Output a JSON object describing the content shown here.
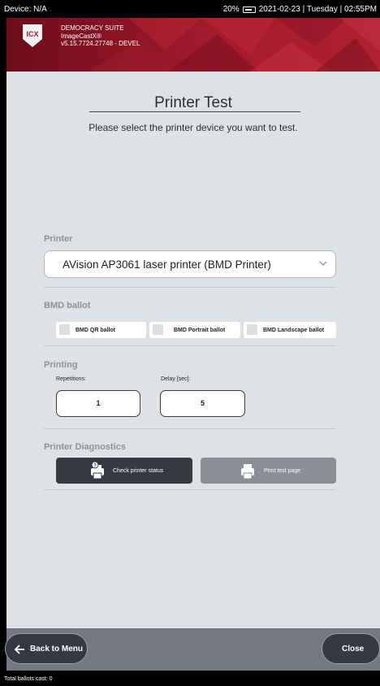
{
  "statusbar": {
    "device": "Device: N/A",
    "battery": "20%",
    "datetime": "2021-02-23 | Tuesday | 02:55PM"
  },
  "header": {
    "logo_text": "ICX",
    "suite": "DEMOCRACY SUITE",
    "product": "ImageCastX®",
    "version": "v5.15.7724.27748 - DEVEL"
  },
  "page": {
    "title": "Printer Test",
    "subtitle": "Please select the printer device you want to test."
  },
  "printer": {
    "label": "Printer",
    "selected": "AVision AP3061 laser printer (BMD Printer)"
  },
  "bmd_ballot": {
    "label": "BMD ballot",
    "options": [
      {
        "label": "BMD QR ballot",
        "checked": false
      },
      {
        "label": "BMD Portrait ballot",
        "checked": false
      },
      {
        "label": "BMD Landscape ballot",
        "checked": false
      }
    ]
  },
  "printing": {
    "label": "Printing",
    "repetitions_label": "Repetitions:",
    "repetitions": "1",
    "delay_label": "Delay [sec]:",
    "delay": "5"
  },
  "diagnostics": {
    "label": "Printer Diagnostics",
    "check_status": "Check printer status",
    "print_test": "Print test page"
  },
  "footer": {
    "back": "Back to Menu",
    "close": "Close"
  },
  "bottombar": {
    "ballots": "Total ballots cast: 0"
  },
  "colors": {
    "brand_red": "#a61b2c",
    "panel_bg": "#dfe2e5",
    "dark_button": "#353a40",
    "disabled_button": "#8a8f95"
  }
}
